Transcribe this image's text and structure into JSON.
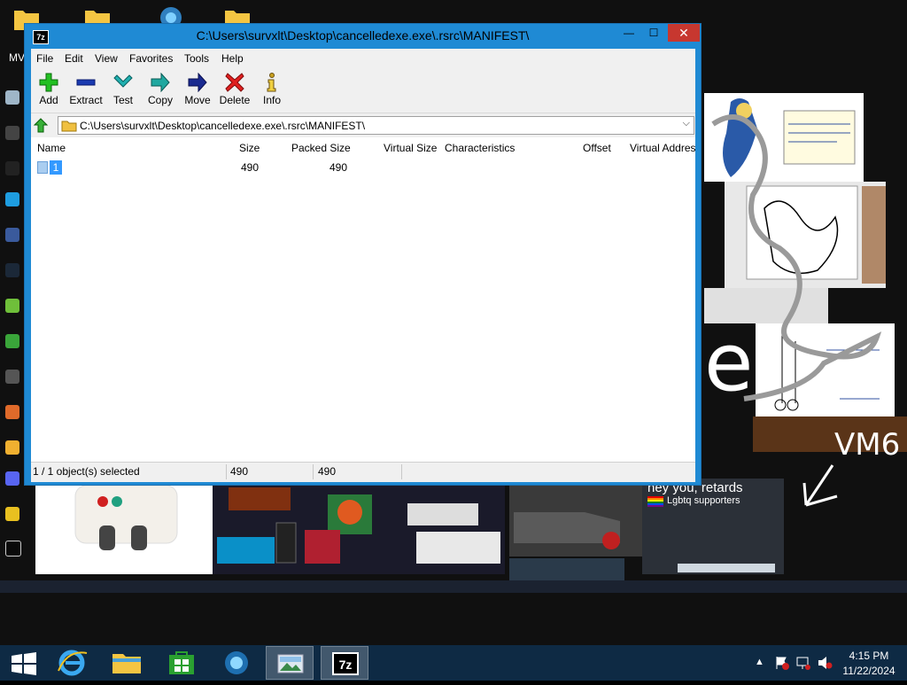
{
  "window": {
    "title": "C:\\Users\\survxlt\\Desktop\\cancelledexe.exe\\.rsrc\\MANIFEST\\",
    "app_icon": "7z",
    "close_glyph": "✕",
    "max_glyph": "☐",
    "min_glyph": "—"
  },
  "menu": [
    "File",
    "Edit",
    "View",
    "Favorites",
    "Tools",
    "Help"
  ],
  "toolbar": {
    "add": "Add",
    "extract": "Extract",
    "test": "Test",
    "copy": "Copy",
    "move": "Move",
    "delete": "Delete",
    "info": "Info"
  },
  "address": {
    "path": "C:\\Users\\survxlt\\Desktop\\cancelledexe.exe\\.rsrc\\MANIFEST\\"
  },
  "columns": [
    "Name",
    "Size",
    "Packed Size",
    "Virtual Size",
    "Characteristics",
    "Offset",
    "Virtual Addres"
  ],
  "rows": [
    {
      "name": "1",
      "size": "490",
      "packed_size": "490"
    }
  ],
  "status": {
    "selected": "1 / 1 object(s) selected",
    "size": "490",
    "packed": "490"
  },
  "desktop": {
    "top_label": "MV",
    "wallpaper_text": {
      "vm6": "VM6",
      "heading": "hey you, retards",
      "lgbtq": "Lgbtq supporters",
      "big_letter": "e"
    }
  },
  "taskbar": {
    "time": "4:15 PM",
    "date": "11/22/2024"
  },
  "colors": {
    "window_frame": "#1f8ad4",
    "close_button": "#c7372f",
    "taskbar": "#0e2a44",
    "selection": "#3399ff"
  }
}
